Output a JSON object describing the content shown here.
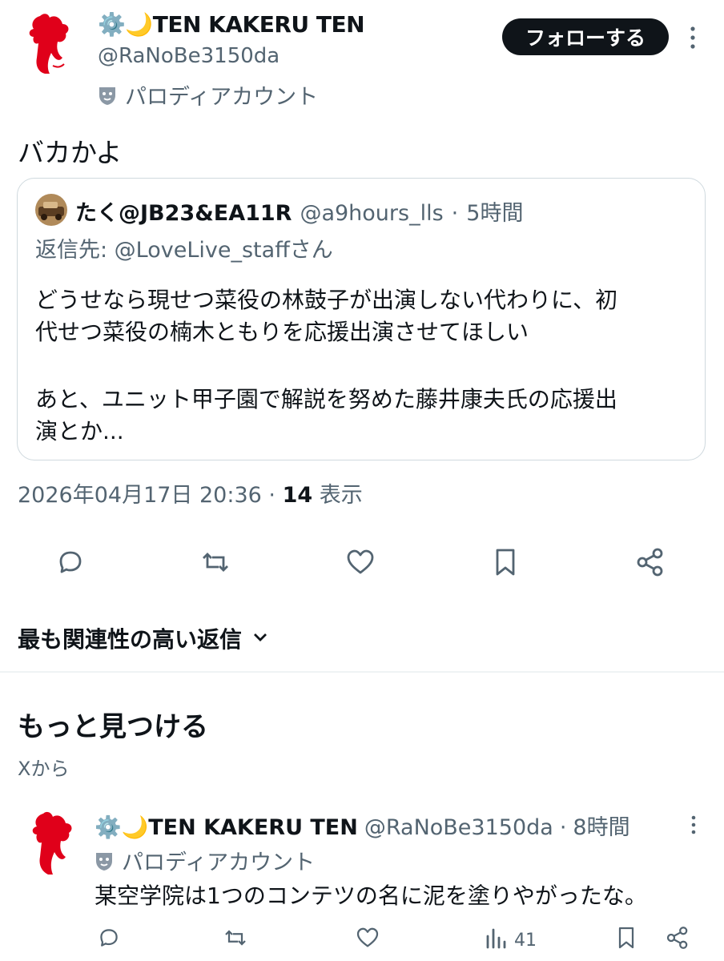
{
  "main_post": {
    "display_name": "⚙️🌙TEN KAKERU TEN",
    "handle": "@RaNoBe3150da",
    "parody_label": "パロディアカウント",
    "follow_label": "フォローする",
    "text": "バカかよ",
    "timestamp": "2026年04月17日 20:36",
    "views_count": "14",
    "views_label": "表示"
  },
  "quoted_post": {
    "display_name": "たく@JB23&EA11R",
    "handle": "@a9hours_lls",
    "time_ago": "5時間",
    "reply_to": "返信先: @LoveLive_staffさん",
    "body_line1": "どうせなら現せつ菜役の林鼓子が出演しない代わりに、初",
    "body_line2": "代せつ菜役の楠木ともりを応援出演させてほしい",
    "body_line3": "あと、ユニット甲子園で解説を努めた藤井康夫氏の応援出",
    "body_line4": "演とか..."
  },
  "actions": [
    "reply-icon",
    "repost-icon",
    "like-icon",
    "bookmark-icon",
    "share-icon"
  ],
  "sort": {
    "label": "最も関連性の高い返信"
  },
  "discover": {
    "title": "もっと見つける",
    "subtitle": "Xから"
  },
  "recommended_post": {
    "display_name": "⚙️🌙TEN KAKERU TEN",
    "handle": "@RaNoBe3150da",
    "time_ago": "8時間",
    "parody_label": "パロディアカウント",
    "text": "某空学院は1つのコンテツの名に泥を塗りやがったな。",
    "views_count": "41"
  },
  "colors": {
    "text_primary": "#0f1419",
    "text_secondary": "#536471",
    "avatar_red": "#e0001a",
    "border": "#cfd9de"
  }
}
